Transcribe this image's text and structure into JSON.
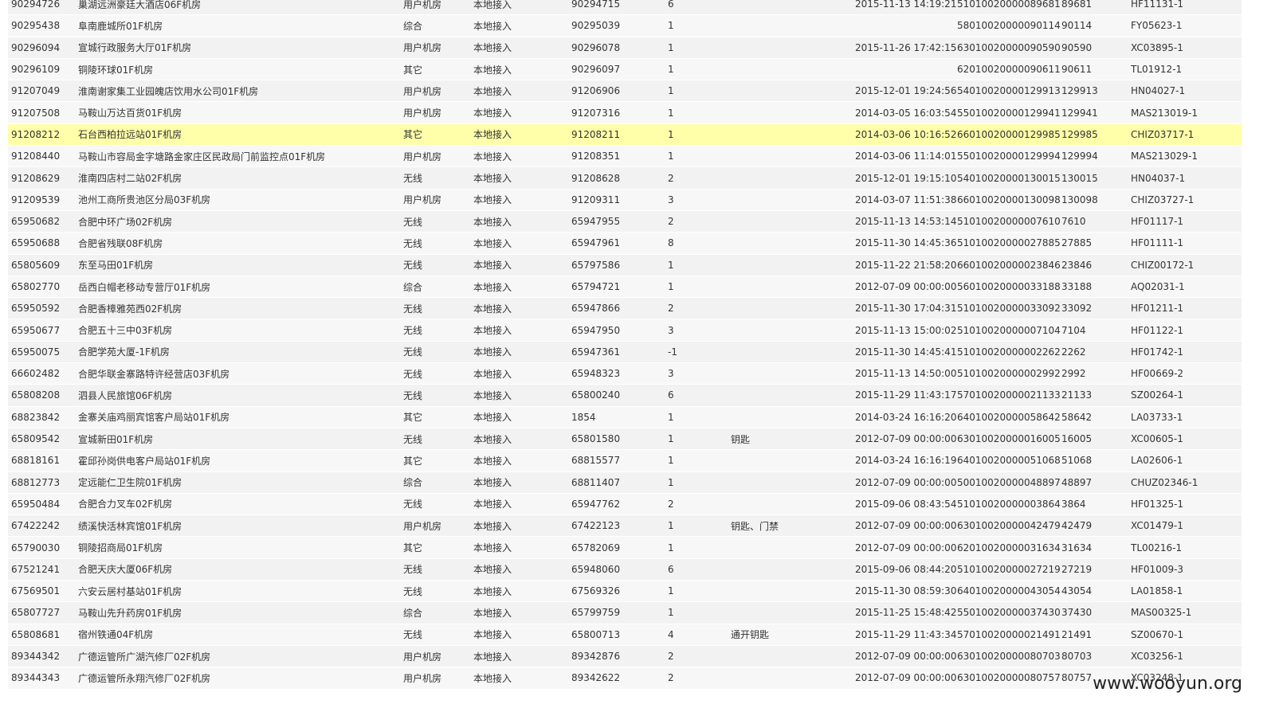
{
  "rows": [
    [
      "90294726",
      "巢湖远洲豪廷大酒店06F机房",
      "用户机房",
      "本地接入",
      "90294715",
      "6",
      "",
      "2015-11-13 14:19:21",
      "51010020000089681",
      "89681",
      "HF11131-1"
    ],
    [
      "90295438",
      "阜南鹿城所01F机房",
      "综合",
      "本地接入",
      "90295039",
      "1",
      "",
      "",
      "58010020000090114",
      "90114",
      "FY05623-1"
    ],
    [
      "90296094",
      "宣城行政服务大厅01F机房",
      "用户机房",
      "本地接入",
      "90296078",
      "1",
      "",
      "2015-11-26 17:42:15",
      "63010020000090590",
      "90590",
      "XC03895-1"
    ],
    [
      "90296109",
      "铜陵环球01F机房",
      "其它",
      "本地接入",
      "90296097",
      "1",
      "",
      "",
      "62010020000090611",
      "90611",
      "TL01912-1"
    ],
    [
      "91207049",
      "淮南谢家集工业园魄店饮用水公司01F机房",
      "用户机房",
      "本地接入",
      "91206906",
      "1",
      "",
      "2015-12-01 19:24:56",
      "54010020000129913",
      "129913",
      "HN04027-1"
    ],
    [
      "91207508",
      "马鞍山万达百货01F机房",
      "用户机房",
      "本地接入",
      "91207316",
      "1",
      "",
      "2014-03-05 16:03:54",
      "55010020000129941",
      "129941",
      "MAS213019-1"
    ],
    [
      "91208212",
      "石台西柏拉远站01F机房",
      "其它",
      "本地接入",
      "91208211",
      "1",
      "",
      "2014-03-06 10:16:52",
      "66010020000129985",
      "129985",
      "CHIZ03717-1"
    ],
    [
      "91208440",
      "马鞍山市容局金字塘路金家庄区民政局门前监控点01F机房",
      "用户机房",
      "本地接入",
      "91208351",
      "1",
      "",
      "2014-03-06 11:14:01",
      "55010020000129994",
      "129994",
      "MAS213029-1"
    ],
    [
      "91208629",
      "淮南四店村二站02F机房",
      "无线",
      "本地接入",
      "91208628",
      "2",
      "",
      "2015-12-01 19:15:10",
      "54010020000130015",
      "130015",
      "HN04037-1"
    ],
    [
      "91209539",
      "池州工商所贵池区分局03F机房",
      "用户机房",
      "本地接入",
      "91209311",
      "3",
      "",
      "2014-03-07 11:51:38",
      "66010020000130098",
      "130098",
      "CHIZ03727-1"
    ],
    [
      "65950682",
      "合肥中环广场02F机房",
      "无线",
      "本地接入",
      "65947955",
      "2",
      "",
      "2015-11-13 14:53:14",
      "51010020000007610",
      "7610",
      "HF01117-1"
    ],
    [
      "65950688",
      "合肥省残联08F机房",
      "无线",
      "本地接入",
      "65947961",
      "8",
      "",
      "2015-11-30 14:45:36",
      "51010020000027885",
      "27885",
      "HF01111-1"
    ],
    [
      "65805609",
      "东至马田01F机房",
      "无线",
      "本地接入",
      "65797586",
      "1",
      "",
      "2015-11-22 21:58:20",
      "66010020000023846",
      "23846",
      "CHIZ00172-1"
    ],
    [
      "65802770",
      "岳西白帽老移动专营厅01F机房",
      "综合",
      "本地接入",
      "65794721",
      "1",
      "",
      "2012-07-09 00:00:00",
      "56010020000033188",
      "33188",
      "AQ02031-1"
    ],
    [
      "65950592",
      "合肥香樟雅苑西02F机房",
      "无线",
      "本地接入",
      "65947866",
      "2",
      "",
      "2015-11-30 17:04:31",
      "51010020000033092",
      "33092",
      "HF01211-1"
    ],
    [
      "65950677",
      "合肥五十三中03F机房",
      "无线",
      "本地接入",
      "65947950",
      "3",
      "",
      "2015-11-13 15:00:02",
      "51010020000007104",
      "7104",
      "HF01122-1"
    ],
    [
      "65950075",
      "合肥学苑大厦-1F机房",
      "无线",
      "本地接入",
      "65947361",
      "-1",
      "",
      "2015-11-30 14:45:41",
      "51010020000002262",
      "2262",
      "HF01742-1"
    ],
    [
      "66602482",
      "合肥华联金寨路特许经营店03F机房",
      "无线",
      "本地接入",
      "65948323",
      "3",
      "",
      "2015-11-13 14:50:00",
      "51010020000002992",
      "2992",
      "HF00669-2"
    ],
    [
      "65808208",
      "泗县人民旅馆06F机房",
      "无线",
      "本地接入",
      "65800240",
      "6",
      "",
      "2015-11-29 11:43:17",
      "57010020000021133",
      "21133",
      "SZ00264-1"
    ],
    [
      "68823842",
      "金寨关庙鸡丽宾馆客户局站01F机房",
      "其它",
      "本地接入",
      "1854",
      "1",
      "",
      "2014-03-24 16:16:20",
      "64010020000058642",
      "58642",
      "LA03733-1"
    ],
    [
      "65809542",
      "宣城新田01F机房",
      "无线",
      "本地接入",
      "65801580",
      "1",
      "钥匙",
      "2012-07-09 00:00:00",
      "63010020000016005",
      "16005",
      "XC00605-1"
    ],
    [
      "68818161",
      "霍邱孙岗供电客户局站01F机房",
      "其它",
      "本地接入",
      "68815577",
      "1",
      "",
      "2014-03-24 16:16:19",
      "64010020000051068",
      "51068",
      "LA02606-1"
    ],
    [
      "68812773",
      "定远能仁卫生院01F机房",
      "综合",
      "本地接入",
      "68811407",
      "1",
      "",
      "2012-07-09 00:00:00",
      "50010020000048897",
      "48897",
      "CHUZ02346-1"
    ],
    [
      "65950484",
      "合肥合力叉车02F机房",
      "无线",
      "本地接入",
      "65947762",
      "2",
      "",
      "2015-09-06 08:43:54",
      "51010020000003864",
      "3864",
      "HF01325-1"
    ],
    [
      "67422242",
      "绩溪快活林宾馆01F机房",
      "用户机房",
      "本地接入",
      "67422123",
      "1",
      "钥匙、门禁",
      "2012-07-09 00:00:00",
      "63010020000042479",
      "42479",
      "XC01479-1"
    ],
    [
      "65790030",
      "铜陵招商局01F机房",
      "其它",
      "本地接入",
      "65782069",
      "1",
      "",
      "2012-07-09 00:00:00",
      "62010020000031634",
      "31634",
      "TL00216-1"
    ],
    [
      "67521241",
      "合肥天庆大厦06F机房",
      "无线",
      "本地接入",
      "65948060",
      "6",
      "",
      "2015-09-06 08:44:20",
      "51010020000027219",
      "27219",
      "HF01009-3"
    ],
    [
      "67569501",
      "六安云居村基站01F机房",
      "无线",
      "本地接入",
      "67569326",
      "1",
      "",
      "2015-11-30 08:59:30",
      "64010020000043054",
      "43054",
      "LA01858-1"
    ],
    [
      "65807727",
      "马鞍山先升药房01F机房",
      "综合",
      "本地接入",
      "65799759",
      "1",
      "",
      "2015-11-25 15:48:42",
      "55010020000037430",
      "37430",
      "MAS00325-1"
    ],
    [
      "65808681",
      "宿州铁通04F机房",
      "无线",
      "本地接入",
      "65800713",
      "4",
      "通开钥匙",
      "2015-11-29 11:43:34",
      "57010020000021491",
      "21491",
      "SZ00670-1"
    ],
    [
      "89344342",
      "广德运管所广湖汽修厂02F机房",
      "用户机房",
      "本地接入",
      "89342876",
      "2",
      "",
      "2012-07-09 00:00:00",
      "63010020000080703",
      "80703",
      "XC03256-1"
    ],
    [
      "89344343",
      "广德运管所永翔汽修厂02F机房",
      "用户机房",
      "本地接入",
      "89342622",
      "2",
      "",
      "2012-07-09 00:00:00",
      "63010020000080757",
      "80757",
      "XC03248-1"
    ]
  ],
  "highlight_row": 6,
  "highlight_color": "#ffffaa",
  "watermark": "www.wooyun.org"
}
